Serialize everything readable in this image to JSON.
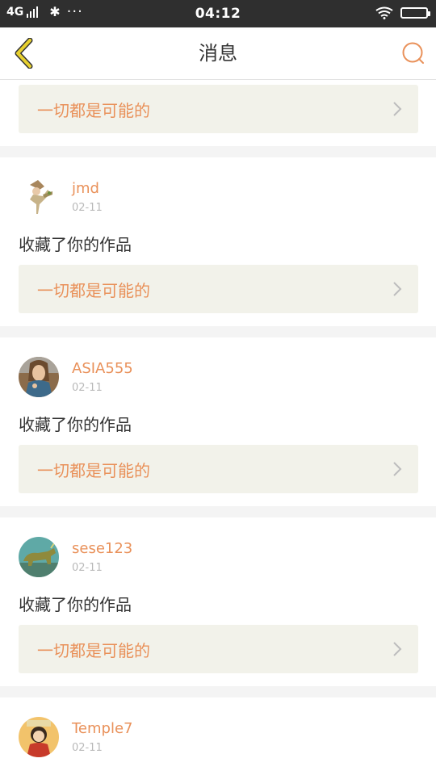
{
  "status_bar": {
    "network": "4G",
    "time": "04:12"
  },
  "header": {
    "title": "消息"
  },
  "colors": {
    "accent": "#e9915a",
    "back_icon": "#e8d12f",
    "link_bg": "#f2f2ea"
  },
  "top_partial": {
    "work_title": "一切都是可能的"
  },
  "notifications": [
    {
      "username": "jmd",
      "date": "02-11",
      "action": "收藏了你的作品",
      "work_title": "一切都是可能的",
      "avatar_icon": "doll-avatar-icon"
    },
    {
      "username": "ASIA555",
      "date": "02-11",
      "action": "收藏了你的作品",
      "work_title": "一切都是可能的",
      "avatar_icon": "portrait-avatar-icon"
    },
    {
      "username": "sese123",
      "date": "02-11",
      "action": "收藏了你的作品",
      "work_title": "一切都是可能的",
      "avatar_icon": "bull-statue-avatar-icon"
    },
    {
      "username": "Temple7",
      "date": "02-11",
      "avatar_icon": "cartoon-avatar-icon"
    }
  ]
}
